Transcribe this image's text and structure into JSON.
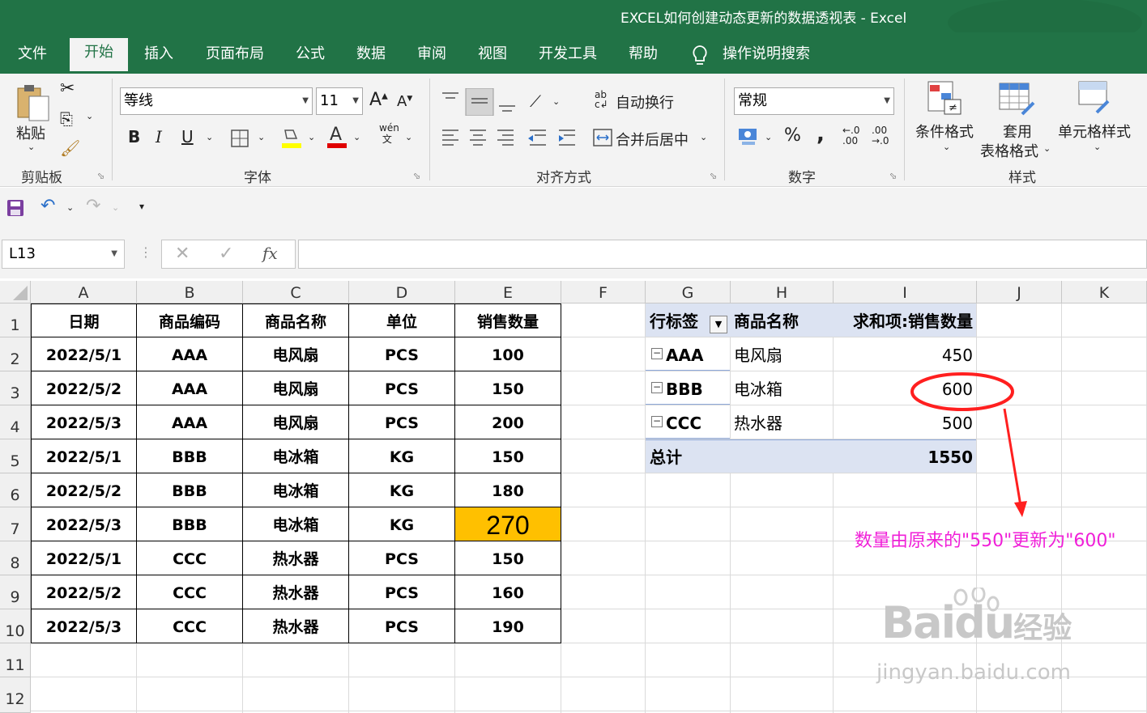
{
  "window": {
    "title": "EXCEL如何创建动态更新的数据透视表  -  Excel"
  },
  "tabs": [
    "文件",
    "开始",
    "插入",
    "页面布局",
    "公式",
    "数据",
    "审阅",
    "视图",
    "开发工具",
    "帮助",
    "操作说明搜索"
  ],
  "ribbon": {
    "paste": "粘贴",
    "clipboard_group": "剪贴板",
    "font_name": "等线",
    "font_size": "11",
    "font_group": "字体",
    "wrap_text": "自动换行",
    "merge_center": "合并后居中",
    "align_group": "对齐方式",
    "number_format": "常规",
    "number_group": "数字",
    "cond_format": "条件格式",
    "table_format_1": "套用",
    "table_format_2": "表格格式",
    "cell_style": "单元格样式",
    "style_group": "样式",
    "bold": "B",
    "italic": "I",
    "underline": "U",
    "percent": "%",
    "comma": ","
  },
  "formula_bar": {
    "name_box": "L13",
    "fx": "fx",
    "formula": ""
  },
  "columns": [
    "A",
    "B",
    "C",
    "D",
    "E",
    "F",
    "G",
    "H",
    "I",
    "J",
    "K"
  ],
  "rows": [
    "1",
    "2",
    "3",
    "4",
    "5",
    "6",
    "7",
    "8",
    "9",
    "10",
    "11",
    "12"
  ],
  "table": {
    "headers": [
      "日期",
      "商品编码",
      "商品名称",
      "单位",
      "销售数量"
    ],
    "rows": [
      [
        "2022/5/1",
        "AAA",
        "电风扇",
        "PCS",
        "100"
      ],
      [
        "2022/5/2",
        "AAA",
        "电风扇",
        "PCS",
        "150"
      ],
      [
        "2022/5/3",
        "AAA",
        "电风扇",
        "PCS",
        "200"
      ],
      [
        "2022/5/1",
        "BBB",
        "电冰箱",
        "KG",
        "150"
      ],
      [
        "2022/5/2",
        "BBB",
        "电冰箱",
        "KG",
        "180"
      ],
      [
        "2022/5/3",
        "BBB",
        "电冰箱",
        "KG",
        "270"
      ],
      [
        "2022/5/1",
        "CCC",
        "热水器",
        "PCS",
        "150"
      ],
      [
        "2022/5/2",
        "CCC",
        "热水器",
        "PCS",
        "160"
      ],
      [
        "2022/5/3",
        "CCC",
        "热水器",
        "PCS",
        "190"
      ]
    ],
    "highlight_color": "#ffc000"
  },
  "pivot": {
    "headers": [
      "行标签",
      "商品名称",
      "求和项:销售数量"
    ],
    "rows": [
      [
        "AAA",
        "电风扇",
        "450"
      ],
      [
        "BBB",
        "电冰箱",
        "600"
      ],
      [
        "CCC",
        "热水器",
        "500"
      ]
    ],
    "total_label": "总计",
    "total_value": "1550",
    "header_color": "#dce3f2"
  },
  "annotation": "数量由原来的\"550\"更新为\"600\"",
  "watermark": {
    "text1": "Bai",
    "text2": "du",
    "text3": "经验",
    "url": "jingyan.baidu.com"
  }
}
